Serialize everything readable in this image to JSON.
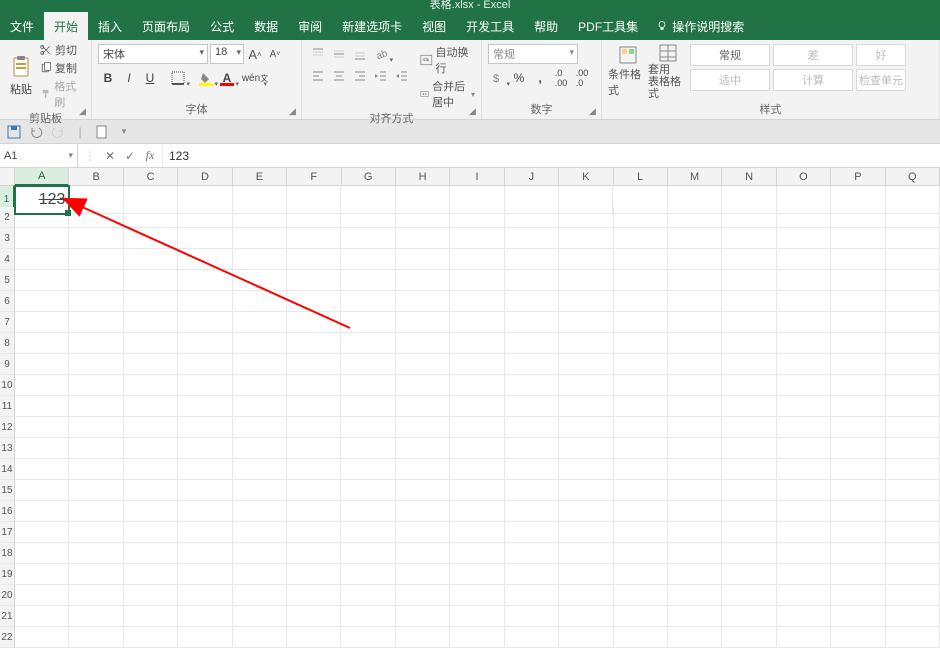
{
  "title": "表格.xlsx - Excel",
  "tabs": [
    "文件",
    "开始",
    "插入",
    "页面布局",
    "公式",
    "数据",
    "审阅",
    "新建选项卡",
    "视图",
    "开发工具",
    "帮助",
    "PDF工具集"
  ],
  "active_tab": "开始",
  "tell_me": "操作说明搜索",
  "clipboard": {
    "paste": "粘贴",
    "cut": "剪切",
    "copy": "复制",
    "format_painter": "格式刷",
    "label": "剪贴板"
  },
  "font": {
    "name": "宋体",
    "size": "18",
    "label": "字体"
  },
  "align": {
    "wrap": "自动换行",
    "merge": "合并后居中",
    "label": "对齐方式"
  },
  "number": {
    "format": "常规",
    "label": "数字"
  },
  "styles": {
    "cond": "条件格式",
    "table": "套用\n表格格式",
    "g1": "常规",
    "g2": "差",
    "g3": "好",
    "g4": "适中",
    "g5": "计算",
    "g6": "检查单元",
    "label": "样式"
  },
  "namebox": "A1",
  "formula": "123",
  "cell_a1": "123",
  "cols": [
    "A",
    "B",
    "C",
    "D",
    "E",
    "F",
    "G",
    "H",
    "I",
    "J",
    "K",
    "L",
    "M",
    "N",
    "O",
    "P",
    "Q"
  ],
  "row_count": 22
}
